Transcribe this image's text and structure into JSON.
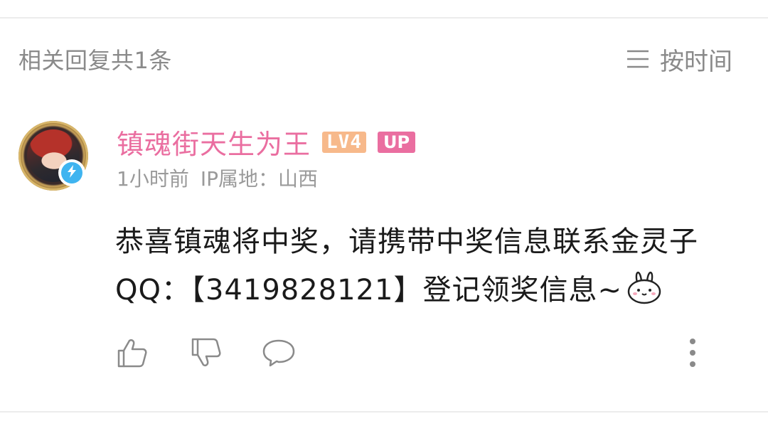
{
  "header": {
    "reply_count": "相关回复共1条",
    "sort_label": "按时间",
    "sort_icon": "menu-lines-icon"
  },
  "comment": {
    "avatar": "avatar",
    "verified_icon": "lightning-bolt-icon",
    "username": "镇魂街天生为王",
    "level": "LV4",
    "role_badge": "UP",
    "time": "1小时前",
    "ip_location": "IP属地：山西",
    "body": "恭喜镇魂将中奖，请携带中奖信息联系金灵子QQ：【3419828121】登记领奖信息~",
    "emoji": "bunny-emoji",
    "actions": {
      "like": "thumbs-up-icon",
      "dislike": "thumbs-down-icon",
      "reply": "comment-bubble-icon",
      "more": "more-vertical-icon"
    }
  },
  "colors": {
    "username": "#ea6ea0",
    "level_badge": "#f7b98b",
    "up_badge": "#ea6ea0",
    "verified": "#3fb4f0",
    "muted_text": "#8a8a8a",
    "body_text": "#1a1a1a"
  }
}
